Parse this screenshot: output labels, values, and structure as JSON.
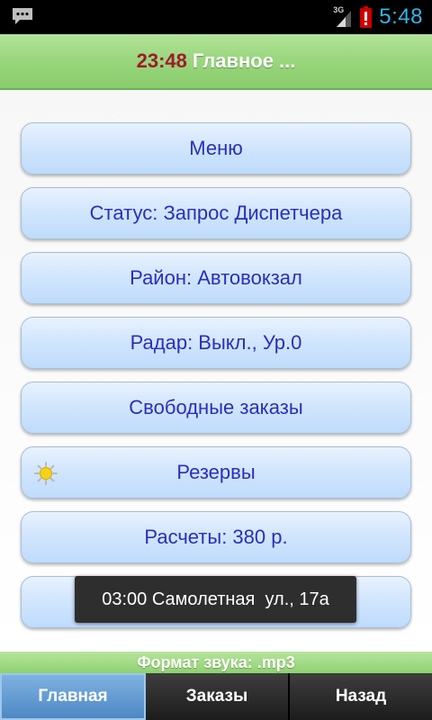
{
  "statusbar": {
    "network_label": "3G",
    "time": "5:48",
    "accent_color": "#33b5e5"
  },
  "titlebar": {
    "time": "23:48",
    "title": "Главное ..."
  },
  "buttons": [
    {
      "label": "Меню"
    },
    {
      "label": "Статус: Запрос Диспетчера"
    },
    {
      "label": "Район: Автовокзал"
    },
    {
      "label": "Радар: Выкл., Ур.0"
    },
    {
      "label": "Свободные заказы"
    },
    {
      "label": "Резервы",
      "icon": "sun-icon"
    },
    {
      "label": "Расчеты: 380 р."
    },
    {
      "label": ""
    }
  ],
  "toast": {
    "text": "03:00 Самолетная  ул., 17а"
  },
  "soundbar": {
    "text": "Формат звука: .mp3"
  },
  "tabs": [
    {
      "label": "Главная",
      "active": true
    },
    {
      "label": "Заказы",
      "active": false
    },
    {
      "label": "Назад",
      "active": false
    }
  ],
  "colors": {
    "button_text": "#2a2fbb",
    "title_time": "#9e1b2a",
    "green_bar": "#9bd77f",
    "active_tab": "#5e95cc"
  }
}
